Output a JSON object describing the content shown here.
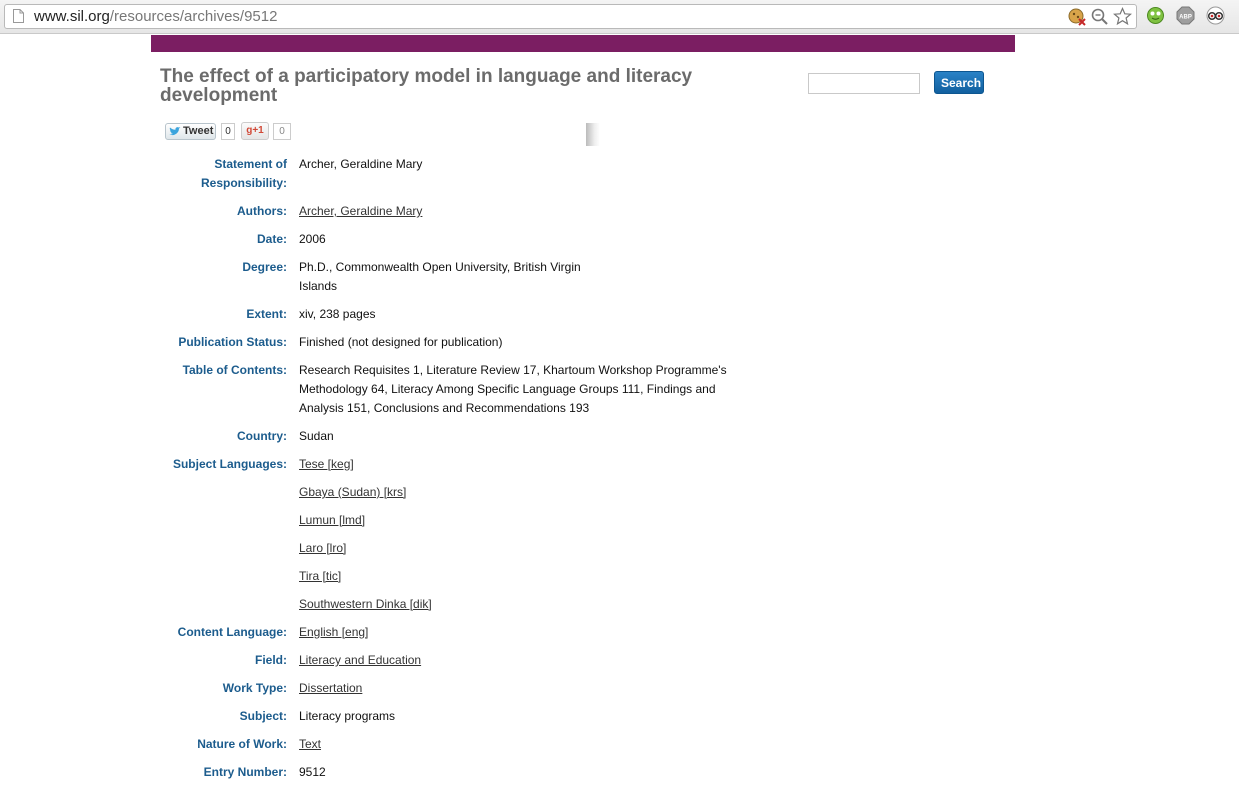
{
  "browser": {
    "url_host": "www.sil.org",
    "url_path": "/resources/archives/9512",
    "omnibox_icons": [
      "cookie-blocked-icon",
      "zoom-icon",
      "bookmark-star-icon"
    ],
    "extension_icons": [
      "frog-extension-icon",
      "adblock-plus-icon",
      "tripadvisor-icon"
    ]
  },
  "brand": {
    "color": "#7b1e62"
  },
  "page": {
    "title": "The effect of a participatory model in language and literacy development"
  },
  "search": {
    "placeholder": "",
    "button_label": "Search"
  },
  "social": {
    "tweet_label": "Tweet",
    "tweet_count": "0",
    "gplus_label": "g+1",
    "gplus_count": "0"
  },
  "record": {
    "statement_label": "Statement of Responsibility:",
    "statement_value": "Archer, Geraldine Mary",
    "authors_label": "Authors:",
    "authors_value": "Archer, Geraldine Mary",
    "date_label": "Date:",
    "date_value": "2006",
    "degree_label": "Degree:",
    "degree_value": "Ph.D., Commonwealth Open University, British Virgin Islands",
    "extent_label": "Extent:",
    "extent_value": "xiv, 238 pages",
    "pubstatus_label": "Publication Status:",
    "pubstatus_value": "Finished (not designed for publication)",
    "toc_label": "Table of Contents:",
    "toc_value": "Research Requisites 1, Literature Review 17, Khartoum Workshop Programme's Methodology 64, Literacy Among Specific Language Groups 111, Findings and Analysis 151, Conclusions and Recommendations 193",
    "country_label": "Country:",
    "country_value": "Sudan",
    "subject_languages_label": "Subject Languages:",
    "subject_languages": [
      "Tese [keg]",
      "Gbaya (Sudan) [krs]",
      "Lumun [lmd]",
      "Laro [lro]",
      "Tira [tic]",
      "Southwestern Dinka [dik]"
    ],
    "content_language_label": "Content Language:",
    "content_language_value": "English [eng]",
    "field_label": "Field:",
    "field_value": "Literacy and Education",
    "worktype_label": "Work Type:",
    "worktype_value": "Dissertation",
    "subject_label": "Subject:",
    "subject_value": "Literacy programs",
    "nature_label": "Nature of Work:",
    "nature_value": "Text",
    "entry_label": "Entry Number:",
    "entry_value": "9512"
  }
}
